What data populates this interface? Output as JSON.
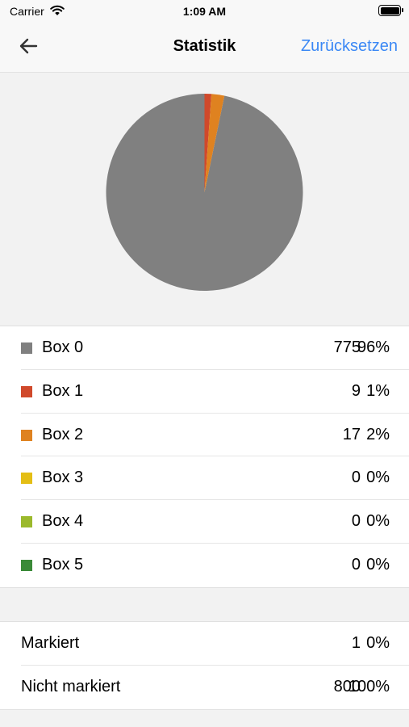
{
  "status_bar": {
    "carrier": "Carrier",
    "time": "1:09 AM"
  },
  "nav": {
    "title": "Statistik",
    "reset_label": "Zurücksetzen"
  },
  "colors": {
    "accent": "#3b88f5"
  },
  "chart_data": {
    "type": "pie",
    "categories": [
      "Box 0",
      "Box 1",
      "Box 2",
      "Box 3",
      "Box 4",
      "Box 5"
    ],
    "values": [
      775,
      9,
      17,
      0,
      0,
      0
    ],
    "colors": [
      "#808080",
      "#d0492b",
      "#df8220",
      "#e4be15",
      "#9bb92c",
      "#3a8a38"
    ]
  },
  "boxes": [
    {
      "label": "Box 0",
      "count": "775",
      "pct": "96%",
      "color": "#808080"
    },
    {
      "label": "Box 1",
      "count": "9",
      "pct": "1%",
      "color": "#d0492b"
    },
    {
      "label": "Box 2",
      "count": "17",
      "pct": "2%",
      "color": "#df8220"
    },
    {
      "label": "Box 3",
      "count": "0",
      "pct": "0%",
      "color": "#e4be15"
    },
    {
      "label": "Box 4",
      "count": "0",
      "pct": "0%",
      "color": "#9bb92c"
    },
    {
      "label": "Box 5",
      "count": "0",
      "pct": "0%",
      "color": "#3a8a38"
    }
  ],
  "marks": [
    {
      "label": "Markiert",
      "count": "1",
      "pct": "0%"
    },
    {
      "label": "Nicht markiert",
      "count": "800",
      "pct": "100%"
    }
  ]
}
